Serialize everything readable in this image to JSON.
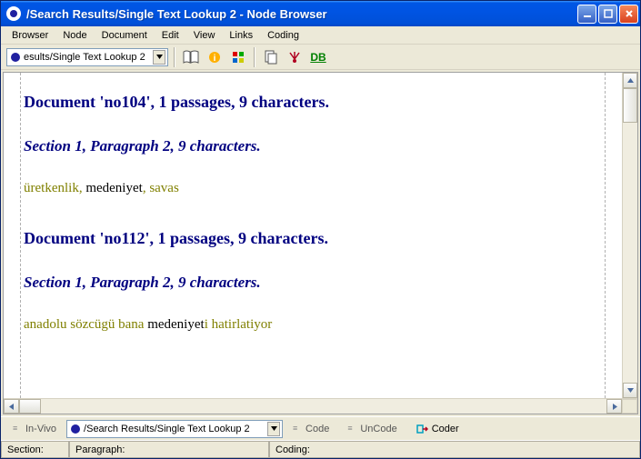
{
  "window": {
    "title": "/Search Results/Single Text Lookup 2 - Node Browser"
  },
  "menu": {
    "items": [
      "Browser",
      "Node",
      "Document",
      "Edit",
      "View",
      "Links",
      "Coding"
    ]
  },
  "toolbar": {
    "combo_text": "esults/Single Text Lookup 2",
    "db_label": "DB"
  },
  "content": {
    "docs": [
      {
        "heading": "Document 'no104',  1 passages, 9 characters.",
        "section": "Section 1, Paragraph 2, 9 characters.",
        "spans": [
          {
            "text": "üretkenlik, ",
            "cls": "w-olive"
          },
          {
            "text": "medeniyet",
            "cls": "w-black"
          },
          {
            "text": ", savas",
            "cls": "w-olive"
          }
        ]
      },
      {
        "heading": "Document 'no112',  1 passages, 9 characters.",
        "section": "Section 1, Paragraph 2, 9 characters.",
        "spans": [
          {
            "text": "anadolu sözcügü bana ",
            "cls": "w-olive"
          },
          {
            "text": "medeniyet",
            "cls": "w-black"
          },
          {
            "text": "i hatirlatiyor",
            "cls": "w-olive"
          }
        ]
      }
    ]
  },
  "bottombar": {
    "invivo": "In-Vivo",
    "combo_text": "/Search Results/Single Text Lookup 2",
    "code": "Code",
    "uncode": "UnCode",
    "coder": "Coder"
  },
  "status": {
    "section_label": "Section:",
    "paragraph_label": "Paragraph:",
    "coding_label": "Coding:"
  }
}
